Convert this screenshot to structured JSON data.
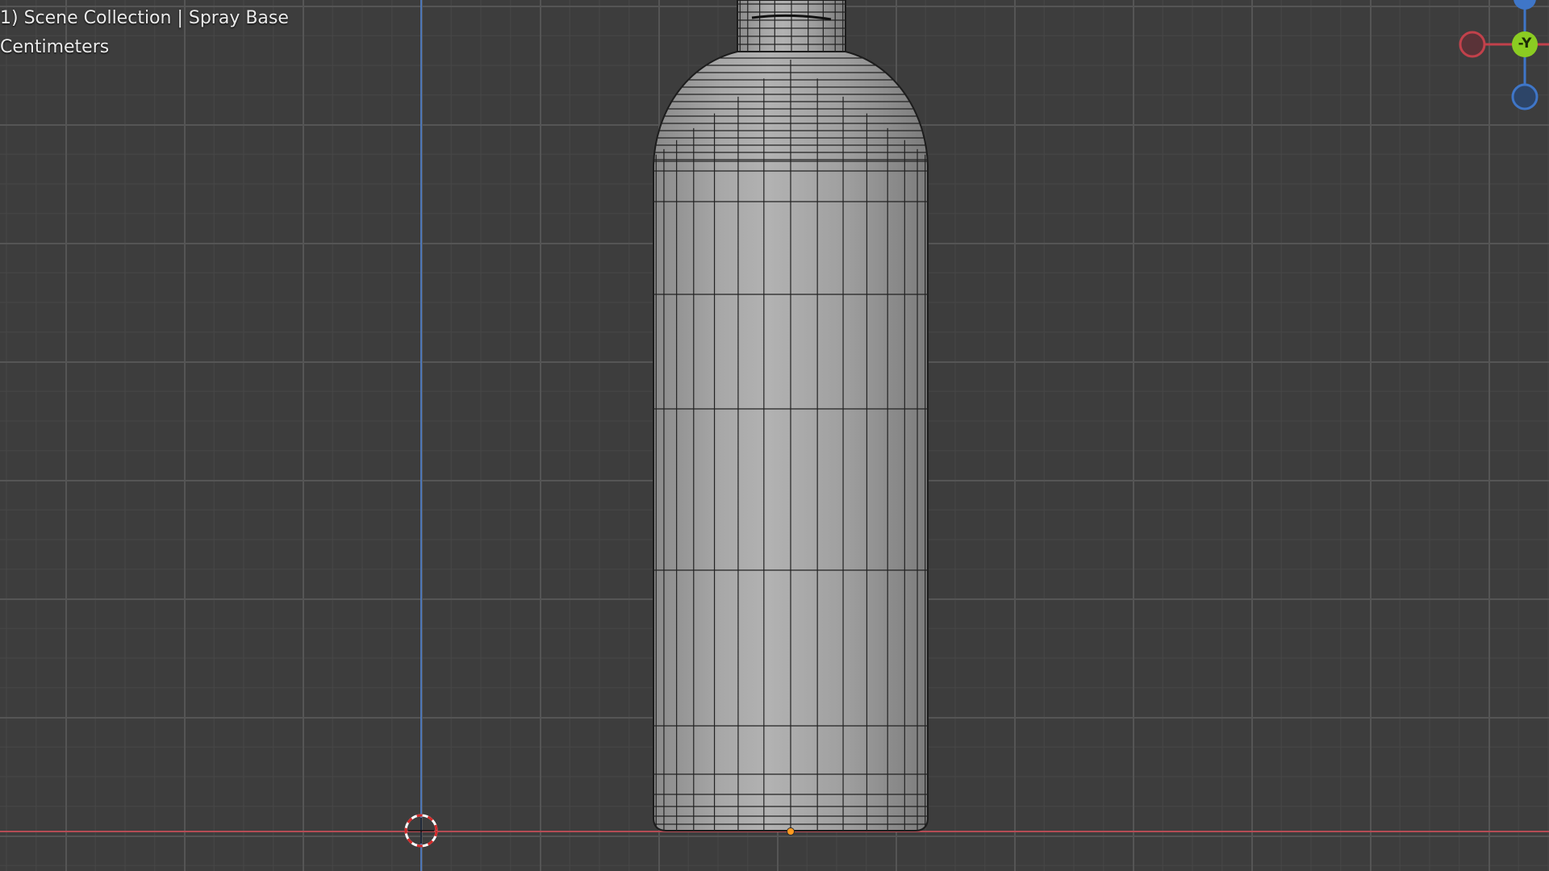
{
  "viewport": {
    "scene_info": "1) Scene Collection | Spray Base",
    "units": "Centimeters"
  },
  "gizmo": {
    "y_label": "-Y",
    "colors": {
      "x": "#c2414b",
      "y": "#8bcc22",
      "z": "#3f76c8"
    }
  },
  "colors": {
    "background": "#3d3d3d",
    "grid_major": "#555555",
    "grid_minor": "#474747",
    "x_axis": "#b54c55",
    "z_axis": "#4d77b8",
    "mesh_wire": "#1c1c1c",
    "origin": "#ff9a1f"
  },
  "mesh_name": "Spray Base",
  "icons": [
    "3d-cursor-icon",
    "object-origin-icon",
    "navigation-gizmo-icon"
  ]
}
